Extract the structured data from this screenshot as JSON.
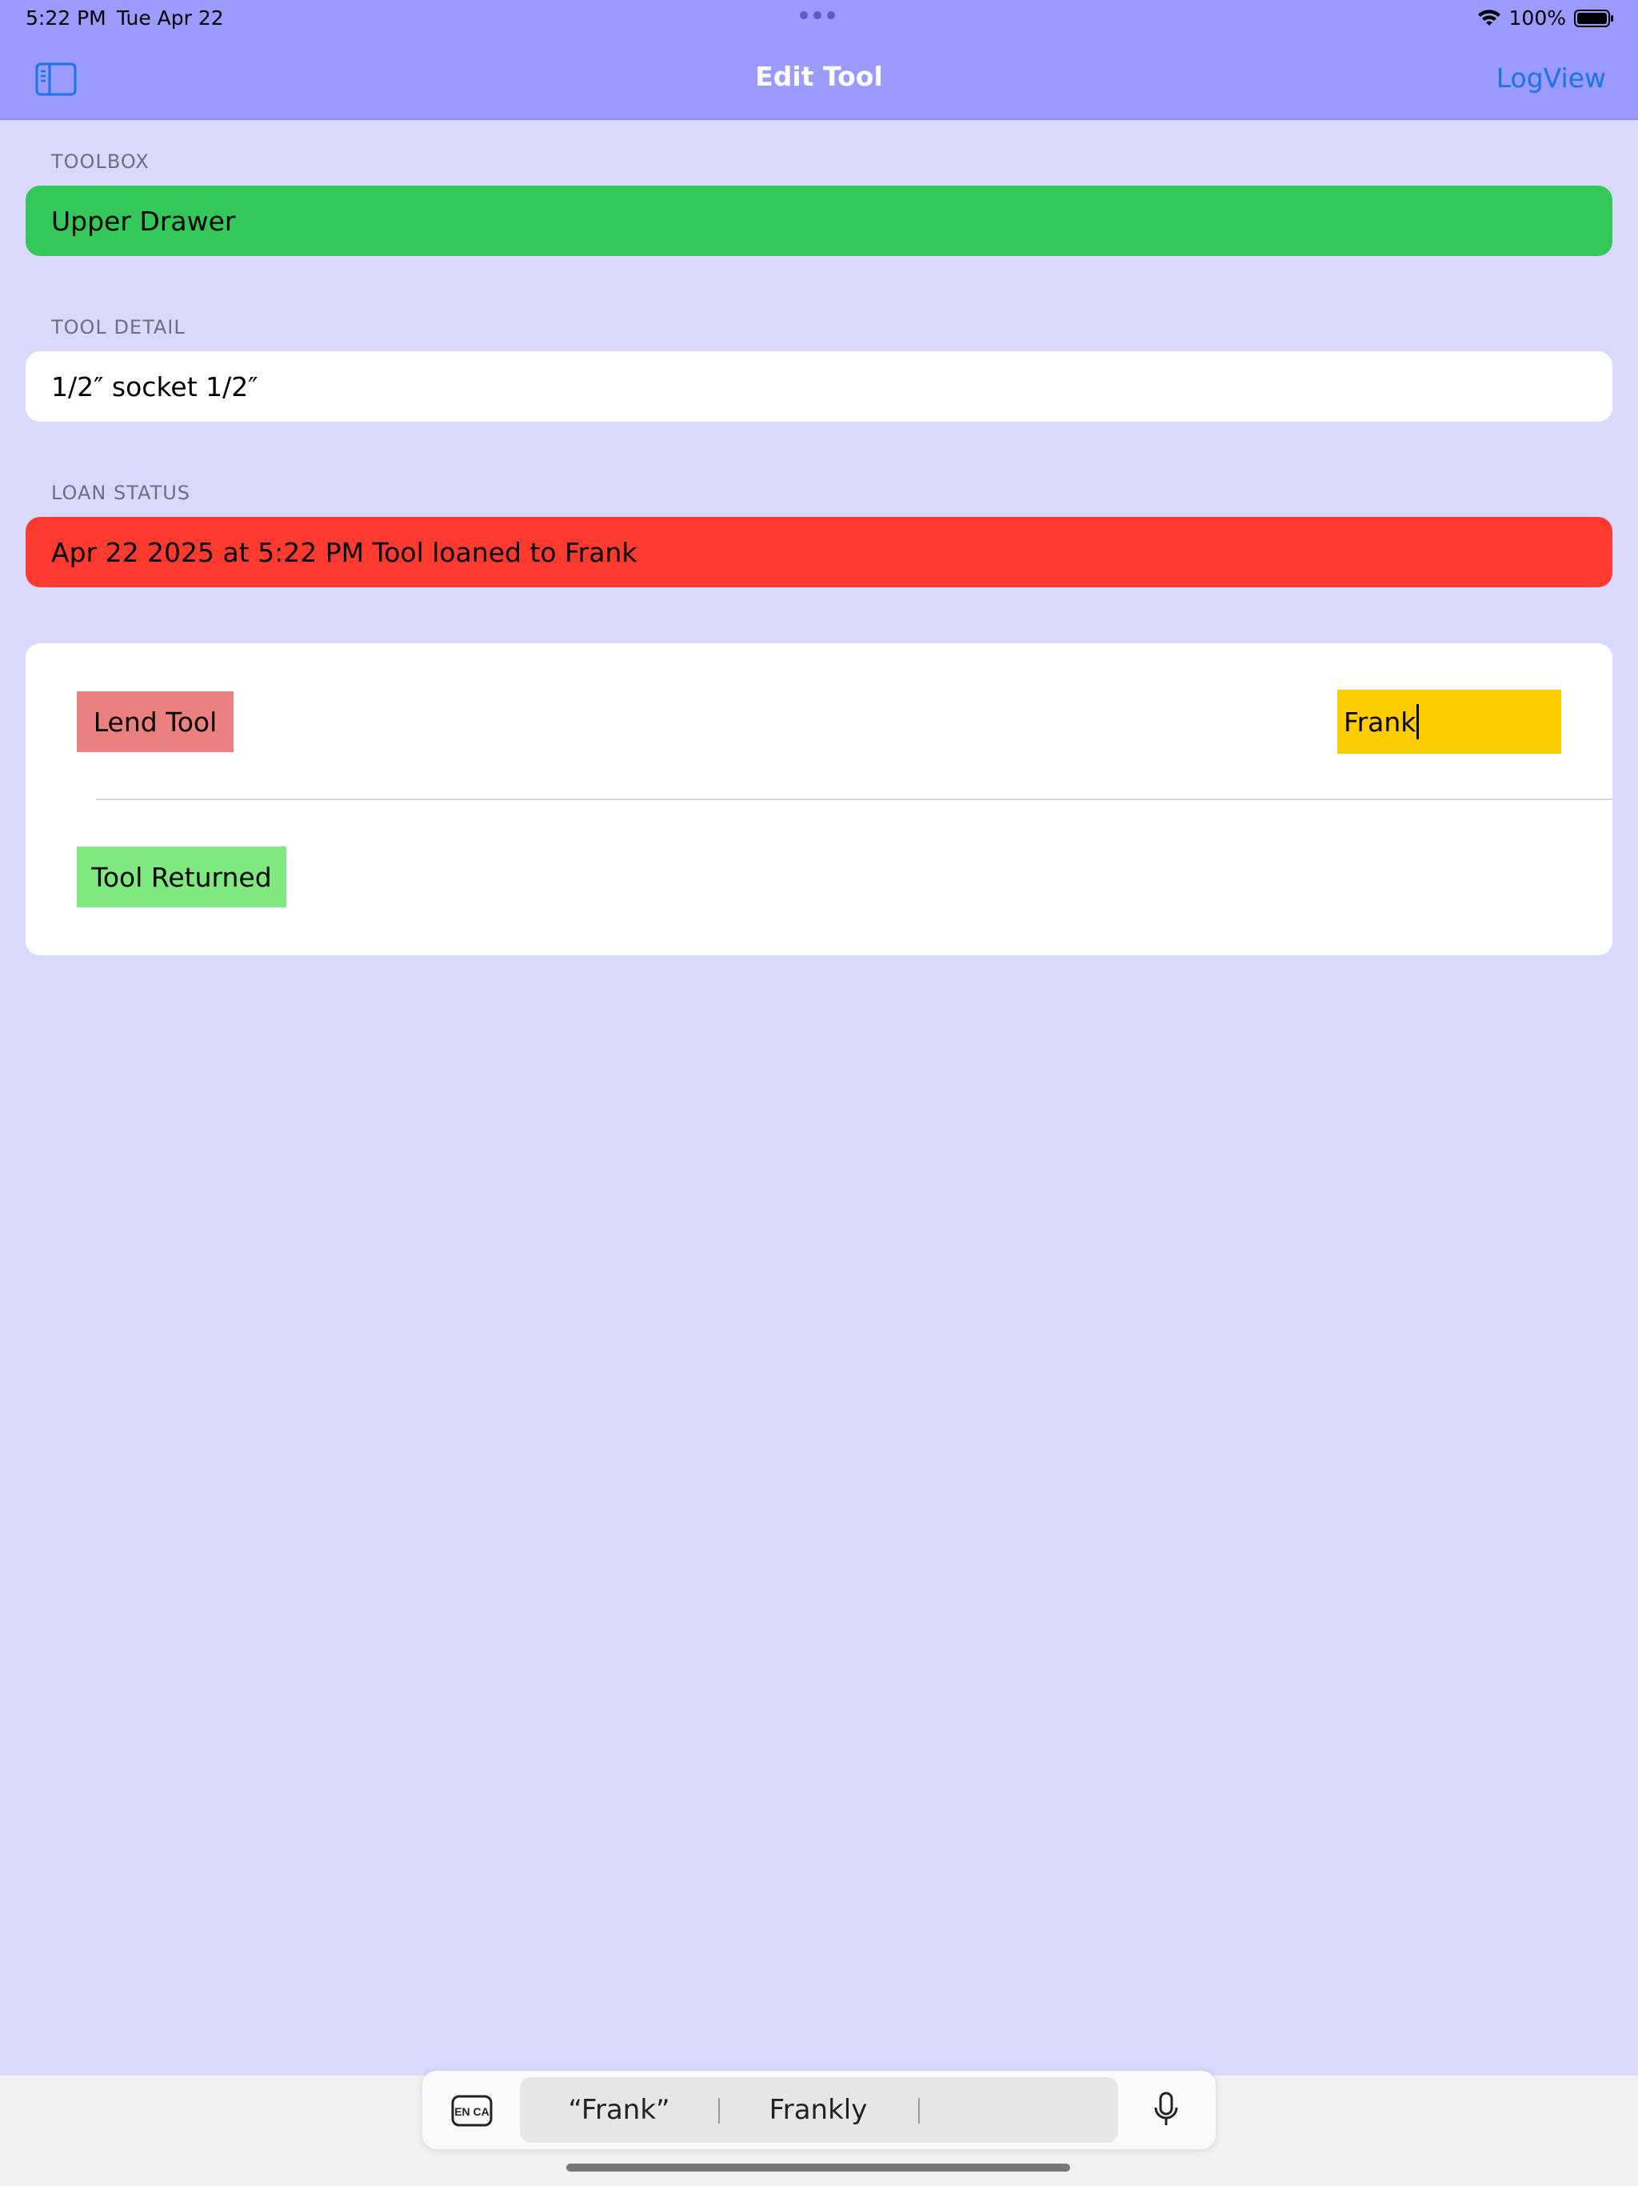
{
  "status_bar": {
    "time": "5:22 PM",
    "date": "Tue Apr 22",
    "battery": "100%",
    "icons": [
      "wifi-icon",
      "battery-icon"
    ]
  },
  "nav": {
    "title": "Edit Tool",
    "right_button": "LogView",
    "left_icon": "sidebar-icon"
  },
  "sections": {
    "toolbox": {
      "header": "TOOLBOX",
      "value": "Upper Drawer"
    },
    "tool_detail": {
      "header": "TOOL DETAIL",
      "value": "1/2″ socket 1/2″"
    },
    "loan_status": {
      "header": "LOAN STATUS",
      "value": "Apr 22 2025 at 5:22 PM Tool loaned to  Frank"
    }
  },
  "actions": {
    "lend_label": "Lend Tool",
    "borrower_value": "Frank",
    "returned_label": "Tool Returned"
  },
  "keyboard": {
    "language": "EN CA",
    "suggestions": [
      "“Frank”",
      "Frankly",
      ""
    ]
  },
  "colors": {
    "nav_bg": "#9a9aff",
    "page_bg": "#d9d9fd",
    "toolbox_bg": "#34c759",
    "loan_bg": "#ff3b30",
    "lend_bg": "#eb8080",
    "returned_bg": "#7fe87f",
    "field_bg": "#ffcc00",
    "link": "#1a73e8"
  }
}
